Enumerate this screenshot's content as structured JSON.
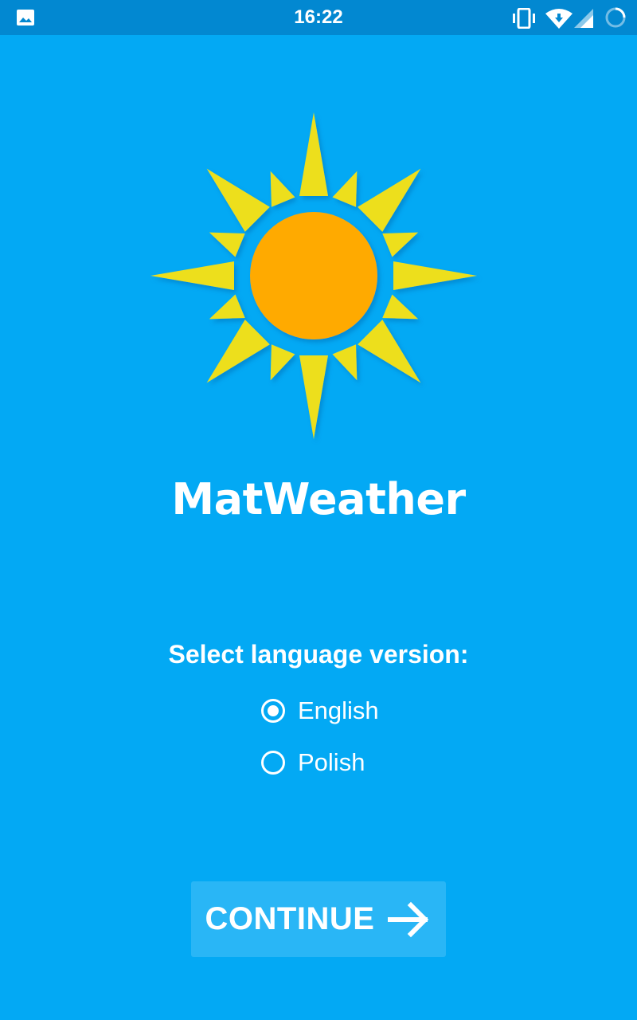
{
  "status_bar": {
    "time": "16:22",
    "left_icons": [
      "image-icon"
    ],
    "right_icons": [
      "vibrate-icon",
      "wifi-icon",
      "cell-signal-icon",
      "sync-icon"
    ],
    "background_color": "#0288d1"
  },
  "app": {
    "logo_icon": "sun-icon",
    "title": "MatWeather",
    "background_color": "#03a9f4",
    "sun_ray_color": "#eddf1f",
    "sun_core_color": "#ffaa00"
  },
  "language": {
    "prompt": "Select language version:",
    "options": [
      {
        "label": "English",
        "selected": true
      },
      {
        "label": "Polish",
        "selected": false
      }
    ]
  },
  "continue_button": {
    "label": "CONTINUE",
    "icon": "arrow-right-icon",
    "background_color": "#29b6f6"
  }
}
